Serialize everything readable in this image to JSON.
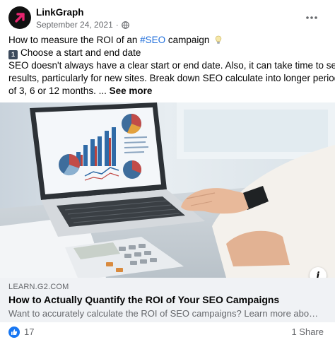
{
  "post": {
    "page_name": "LinkGraph",
    "date": "September 24, 2021",
    "audience_icon": "globe-icon",
    "menu_icon": "more-horizontal-icon",
    "text": {
      "line1_prefix": "How to measure the ROI of an ",
      "line1_hashtag": "#SEO",
      "line1_suffix": " campaign",
      "line1_emoji": "light-bulb-icon",
      "line2_keycap": "1",
      "line2": "Choose a start and end date",
      "line3": "SEO doesn't always have a clear start or end date. Also, it can take time to see",
      "line4": "results, particularly for new sites. Break down SEO calculate into longer periods",
      "line5_prefix": "of 3, 6 or 12 months. ... ",
      "see_more": "See more"
    },
    "link_preview": {
      "domain": "LEARN.G2.COM",
      "title": "How to Actually Quantify the ROI of Your SEO Campaigns",
      "description": "Want to accurately calculate the ROI of SEO campaigns? Learn more about how to measure it here."
    },
    "footer": {
      "reaction_icon": "like-icon",
      "reaction_count": "17",
      "shares": "1 Share"
    },
    "colors": {
      "hashtag": "#216fdb",
      "avatar_accent": "#e8246f",
      "like": "#1877f2"
    }
  }
}
